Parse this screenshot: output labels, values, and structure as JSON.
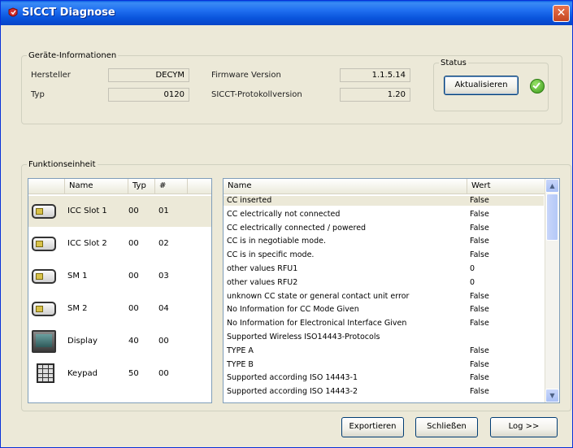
{
  "window": {
    "title": "SICCT Diagnose",
    "close_glyph": "✕",
    "title_color": "#0a55dc"
  },
  "geraete": {
    "legend": "Geräte-Informationen",
    "hersteller_label": "Hersteller",
    "hersteller_value": "DECYM",
    "typ_label": "Typ",
    "typ_value": "0120",
    "firmware_label": "Firmware Version",
    "firmware_value": "1.1.5.14",
    "protokoll_label": "SICCT-Protokollversion",
    "protokoll_value": "1.20"
  },
  "status": {
    "legend": "Status",
    "refresh_label": "Aktualisieren",
    "status_icon": "green-check-icon"
  },
  "funktion": {
    "legend": "Funktionseinheit",
    "units_columns": [
      "Name",
      "Typ",
      "#"
    ],
    "units": [
      {
        "name": "ICC Slot 1",
        "typ": "00",
        "num": "01",
        "icon": "card-reader-icon",
        "selected": true
      },
      {
        "name": "ICC Slot 2",
        "typ": "00",
        "num": "02",
        "icon": "card-reader-icon",
        "selected": false
      },
      {
        "name": "SM 1",
        "typ": "00",
        "num": "03",
        "icon": "card-reader-icon",
        "selected": false
      },
      {
        "name": "SM 2",
        "typ": "00",
        "num": "04",
        "icon": "card-reader-icon",
        "selected": false
      },
      {
        "name": "Display",
        "typ": "40",
        "num": "00",
        "icon": "display-icon",
        "selected": false
      },
      {
        "name": "Keypad",
        "typ": "50",
        "num": "00",
        "icon": "keypad-icon",
        "selected": false
      }
    ],
    "props_columns": [
      "Name",
      "Wert"
    ],
    "props": [
      {
        "name": "CC inserted",
        "value": "False",
        "selected": true
      },
      {
        "name": "CC electrically not connected",
        "value": "False"
      },
      {
        "name": "CC electrically connected / powered",
        "value": "False"
      },
      {
        "name": "CC is in negotiable mode.",
        "value": "False"
      },
      {
        "name": "CC is in specific mode.",
        "value": "False"
      },
      {
        "name": "other values RFU1",
        "value": "0"
      },
      {
        "name": "other values RFU2",
        "value": "0"
      },
      {
        "name": "unknown CC state or general contact unit error",
        "value": "False"
      },
      {
        "name": "No Information for CC Mode Given",
        "value": "False"
      },
      {
        "name": "No Information for Electronical Interface Given",
        "value": "False"
      },
      {
        "name": "Supported Wireless ISO14443-Protocols",
        "value": ""
      },
      {
        "name": "TYPE A",
        "value": "False"
      },
      {
        "name": "TYPE B",
        "value": "False"
      },
      {
        "name": "Supported according ISO 14443-1",
        "value": "False"
      },
      {
        "name": "Supported according ISO 14443-2",
        "value": "False"
      }
    ]
  },
  "buttons": {
    "export_label": "Exportieren",
    "close_label": "Schließen",
    "log_label": "Log >>"
  },
  "scrollbar": {
    "up_glyph": "▲",
    "down_glyph": "▼"
  }
}
